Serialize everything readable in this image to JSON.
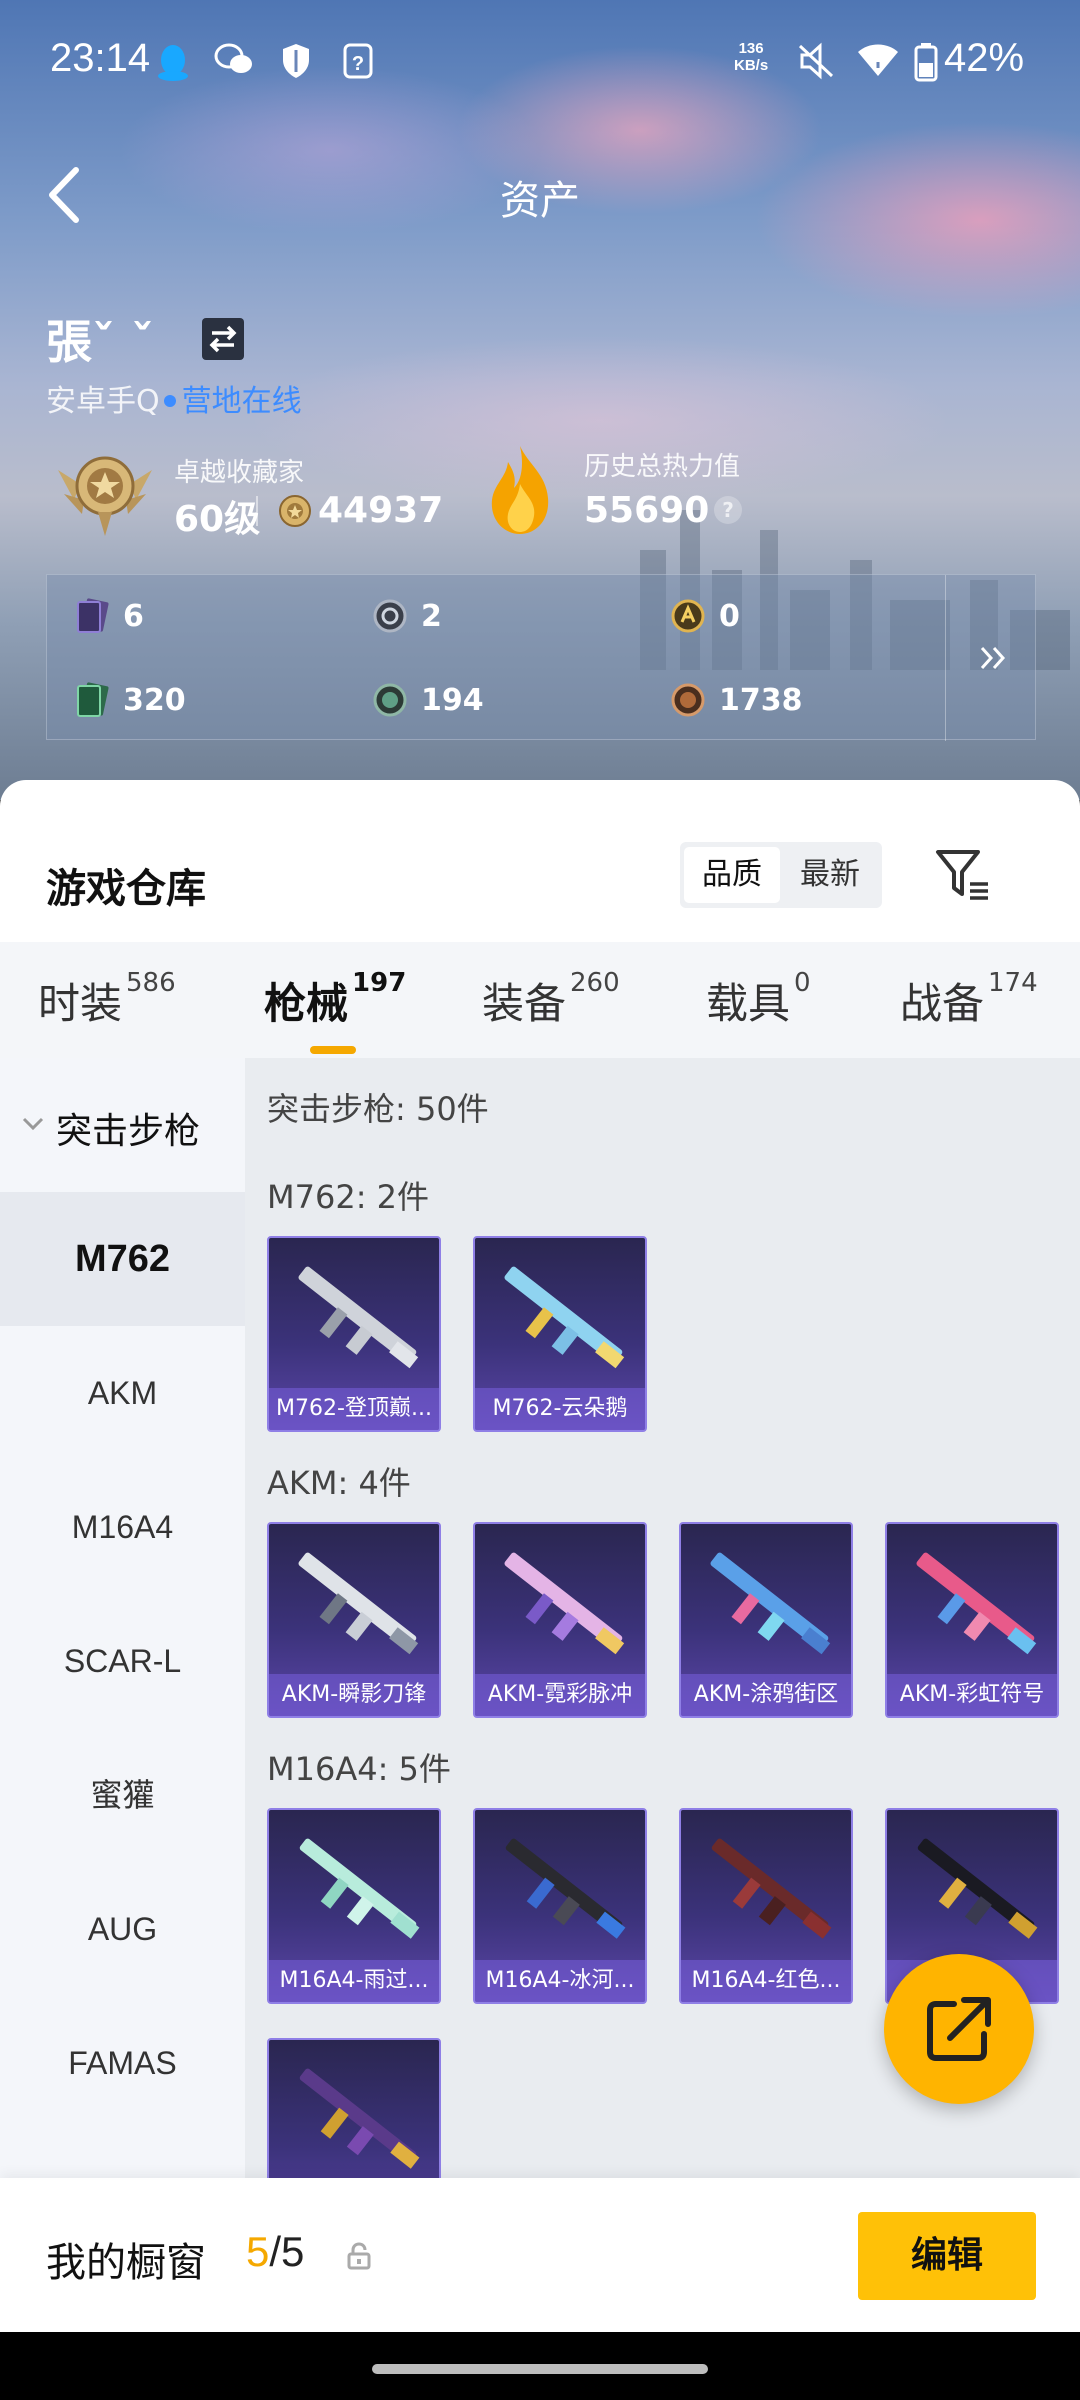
{
  "status_bar": {
    "time": "23:14",
    "net_speed_value": "136",
    "net_speed_unit": "KB/s",
    "battery": "42%",
    "icons": [
      "qq-icon",
      "wechat-icon",
      "shield-icon",
      "question-box-icon",
      "mute-icon",
      "wifi-icon",
      "battery-icon"
    ]
  },
  "header": {
    "title": "资产"
  },
  "profile": {
    "name": "張ˇ ˇ",
    "platform": "安卓手Q",
    "online_status": "营地在线",
    "rank_title": "卓越收藏家",
    "rank_level": "60级",
    "rank_points": "44937",
    "heat_title": "历史总热力值",
    "heat_value": "55690",
    "help_mark": "?"
  },
  "currencies": [
    {
      "icon": "purple-card-icon",
      "value": "6"
    },
    {
      "icon": "silver-coin-icon",
      "value": "2"
    },
    {
      "icon": "gold-coin-icon",
      "value": "0"
    },
    {
      "icon": "green-card-icon",
      "value": "320"
    },
    {
      "icon": "green-orb-icon",
      "value": "194"
    },
    {
      "icon": "bronze-orb-icon",
      "value": "1738"
    }
  ],
  "warehouse": {
    "title": "游戏仓库",
    "sort_options": [
      "品质",
      "最新"
    ],
    "sort_active": "品质",
    "tabs": [
      {
        "label": "时装",
        "count": "586"
      },
      {
        "label": "枪械",
        "count": "197"
      },
      {
        "label": "装备",
        "count": "260"
      },
      {
        "label": "载具",
        "count": "0"
      },
      {
        "label": "战备",
        "count": "174"
      }
    ],
    "active_tab": "枪械"
  },
  "sidebar": {
    "category": "突击步枪",
    "items": [
      "M762",
      "AKM",
      "M16A4",
      "SCAR-L",
      "蜜獾",
      "AUG",
      "FAMAS"
    ],
    "active": "M762"
  },
  "content": {
    "category_header": "突击步枪: 50件",
    "groups": [
      {
        "header": "M762: 2件",
        "items": [
          "M762-登顶巅...",
          "M762-云朵鹅"
        ]
      },
      {
        "header": "AKM: 4件",
        "items": [
          "AKM-瞬影刀锋",
          "AKM-霓彩脉冲",
          "AKM-涂鸦街区",
          "AKM-彩虹符号"
        ]
      },
      {
        "header": "M16A4: 5件",
        "items": [
          "M16A4-雨过...",
          "M16A4-冰河...",
          "M16A4-红色...",
          "..."
        ]
      }
    ]
  },
  "showcase": {
    "label": "我的橱窗",
    "current": "5",
    "separator": "/",
    "max": "5",
    "edit_label": "编辑"
  },
  "colors": {
    "accent": "#f5a800",
    "edit_button": "#ffc107",
    "online_blue": "#3d8cff",
    "card_purple": "#3b327a"
  }
}
